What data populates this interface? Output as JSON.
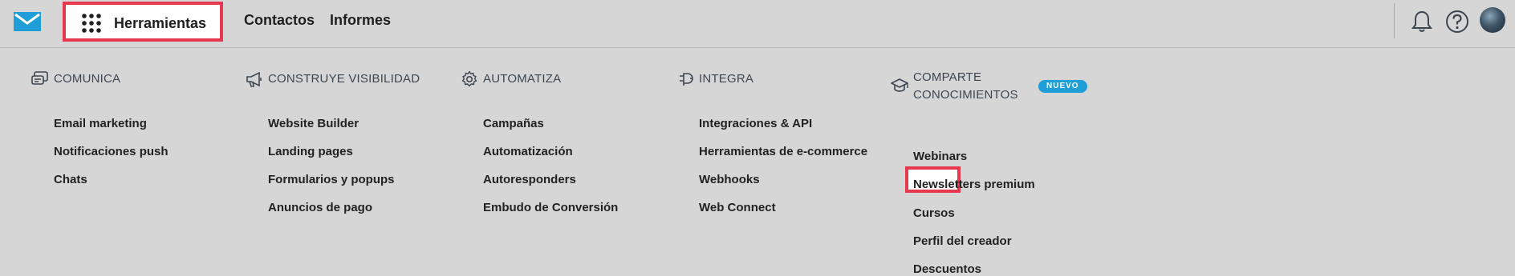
{
  "header": {
    "tools_label": "Herramientas",
    "nav": [
      "Contactos",
      "Informes"
    ],
    "icons": [
      "envelope-logo-icon",
      "grid-dots-icon",
      "bell-icon",
      "help-icon",
      "avatar"
    ]
  },
  "menu": {
    "columns": [
      {
        "title": "COMUNICA",
        "icon": "chat-icon",
        "items": [
          "Email marketing",
          "Notificaciones push",
          "Chats"
        ]
      },
      {
        "title": "CONSTRUYE VISIBILIDAD",
        "icon": "megaphone-icon",
        "items": [
          "Website Builder",
          "Landing pages",
          "Formularios y popups",
          "Anuncios de pago"
        ]
      },
      {
        "title": "AUTOMATIZA",
        "icon": "gear-icon",
        "items": [
          "Campañas",
          "Automatización",
          "Autoresponders",
          "Embudo de Conversión"
        ]
      },
      {
        "title": "INTEGRA",
        "icon": "plug-icon",
        "items": [
          "Integraciones & API",
          "Herramientas de e-commerce",
          "Webhooks",
          "Web Connect"
        ]
      },
      {
        "title_line1": "COMPARTE",
        "title_line2": "CONOCIMIENTOS",
        "icon": "graduation-cap-icon",
        "badge": "NUEVO",
        "items": [
          "Webinars",
          "Newsletters premium",
          "Cursos",
          "Perfil del creador",
          "Descuentos"
        ]
      }
    ]
  },
  "colors": {
    "background": "#d6d6d6",
    "highlight": "#e8384f",
    "badge": "#1f9ed8",
    "logo": "#1f9ed8"
  }
}
